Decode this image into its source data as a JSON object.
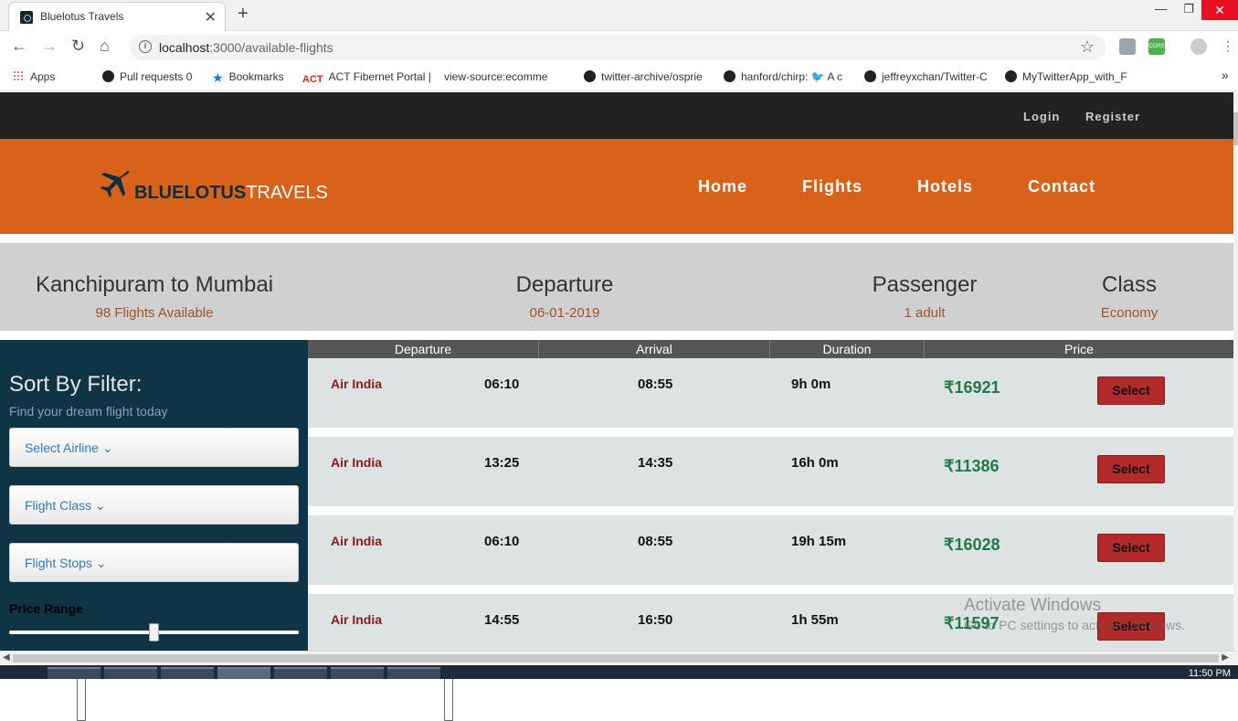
{
  "browser": {
    "tab_title": "Bluelotus Travels",
    "url_host": "localhost",
    "url_rest": ":3000/available-flights",
    "bookmarks": [
      "Apps",
      "Pull requests 0",
      "Bookmarks",
      "ACT Fibernet Portal |",
      "view-source:ecomme",
      "twitter-archive/osprie",
      "hanford/chirp: 🐦 A c",
      "jeffreyxchan/Twitter-C",
      "MyTwitterApp_with_F"
    ],
    "ext_cors": "CORS"
  },
  "topbar": {
    "login": "Login",
    "register": "Register"
  },
  "brand": {
    "part1": "BLUELOTUS",
    "part2": "TRAVELS"
  },
  "nav": {
    "home": "Home",
    "flights": "Flights",
    "hotels": "Hotels",
    "contact": "Contact"
  },
  "summary": {
    "route": "Kanchipuram to Mumbai",
    "count": "98 Flights Available",
    "departure_label": "Departure",
    "departure_date": "06-01-2019",
    "passenger_label": "Passenger",
    "passenger_value": "1 adult",
    "class_label": "Class",
    "class_value": "Economy"
  },
  "sidebar": {
    "title": "Sort By Filter:",
    "subtitle": "Find your dream flight today",
    "airline": "Select Airline ⌄",
    "flight_class": "Flight Class ⌄",
    "flight_stops": "Flight Stops ⌄",
    "price_range": "Price Range"
  },
  "table": {
    "headers": [
      "Departure",
      "Arrival",
      "Duration",
      "Price"
    ],
    "select_label": "Select",
    "rows": [
      {
        "airline": "Air India",
        "departure": "06:10",
        "arrival": "08:55",
        "duration": "9h 0m",
        "price": "₹16921"
      },
      {
        "airline": "Air India",
        "departure": "13:25",
        "arrival": "14:35",
        "duration": "16h 0m",
        "price": "₹11386"
      },
      {
        "airline": "Air India",
        "departure": "06:10",
        "arrival": "08:55",
        "duration": "19h 15m",
        "price": "₹16028"
      },
      {
        "airline": "Air India",
        "departure": "14:55",
        "arrival": "16:50",
        "duration": "1h 55m",
        "price": "₹11597"
      }
    ]
  },
  "watermark": {
    "line1": "Activate Windows",
    "line2": "Go to PC settings to activate Windows."
  },
  "taskbar": {
    "time": "11:50 PM"
  }
}
